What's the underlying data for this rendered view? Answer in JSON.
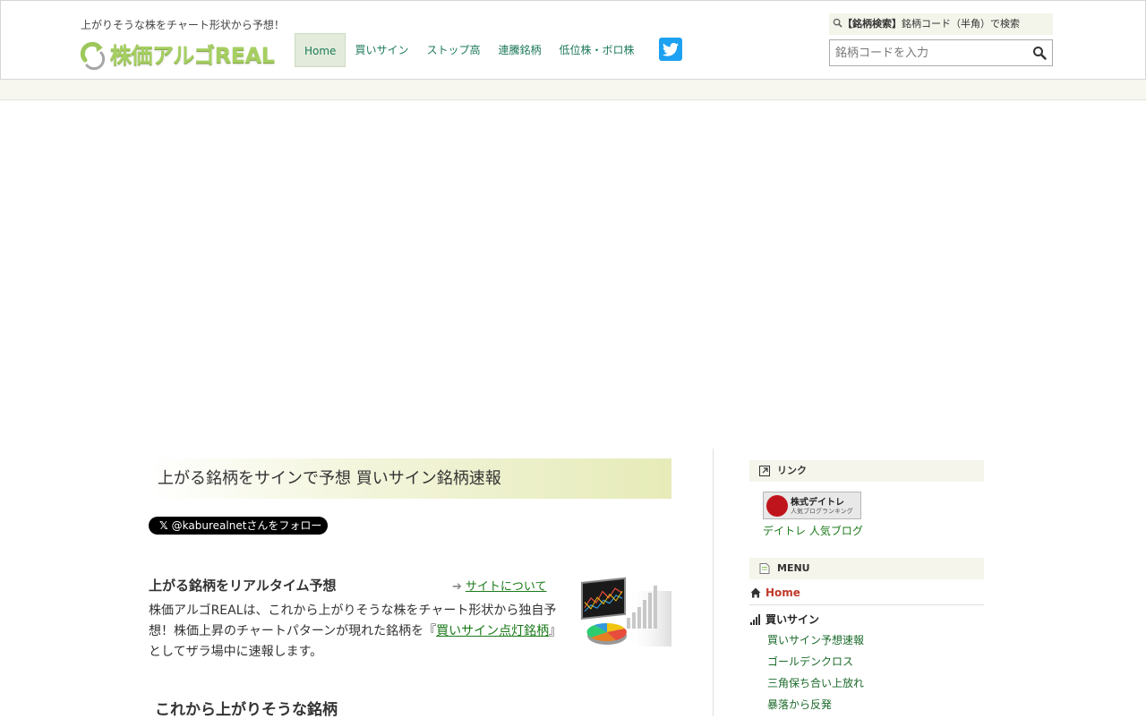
{
  "header": {
    "tagline": "上がりそうな株をチャート形状から予想！",
    "logo_text": "株価アルゴREAL",
    "nav": [
      {
        "label": "Home",
        "active": true
      },
      {
        "label": "買いサイン"
      },
      {
        "label": "ストップ高"
      },
      {
        "label": "連騰銘柄"
      },
      {
        "label": "低位株・ボロ株"
      }
    ],
    "search": {
      "label_bold": "【銘柄検索】",
      "label_rest": "銘柄コード（半角）で検索",
      "placeholder": "銘柄コードを入力"
    }
  },
  "main": {
    "section_title": "上がる銘柄をサインで予想 買いサイン銘柄速報",
    "follow_button": "@kaburealnetさんをフォロー",
    "intro_heading": "上がる銘柄をリアルタイム予想",
    "about_link": "サイトについて",
    "intro_text_1": "株価アルゴREALは、これから上がりそうな株をチャート形状から独自予想！株価上昇のチャートパターンが現れた銘柄を『",
    "intro_link": "買いサイン点灯銘柄",
    "intro_text_2": "』としてザラ場中に速報します。",
    "rising_heading": "これから上がりそうな銘柄"
  },
  "sidebar": {
    "link_heading": "リンク",
    "banner_title": "株式デイトレ",
    "banner_sub": "人気ブログランキング",
    "blog_link": "デイトレ 人気ブログ",
    "menu_heading": "MENU",
    "menu_home": "Home",
    "menu_category": "買いサイン",
    "menu_items": [
      "買いサイン予想速報",
      "ゴールデンクロス",
      "三角保ち合い上放れ",
      "暴落から反発"
    ]
  },
  "colors": {
    "accent_green": "#1d7a5a",
    "logo_green": "#a6cf62",
    "twitter_blue": "#1da1f2",
    "home_red": "#c0392b"
  }
}
